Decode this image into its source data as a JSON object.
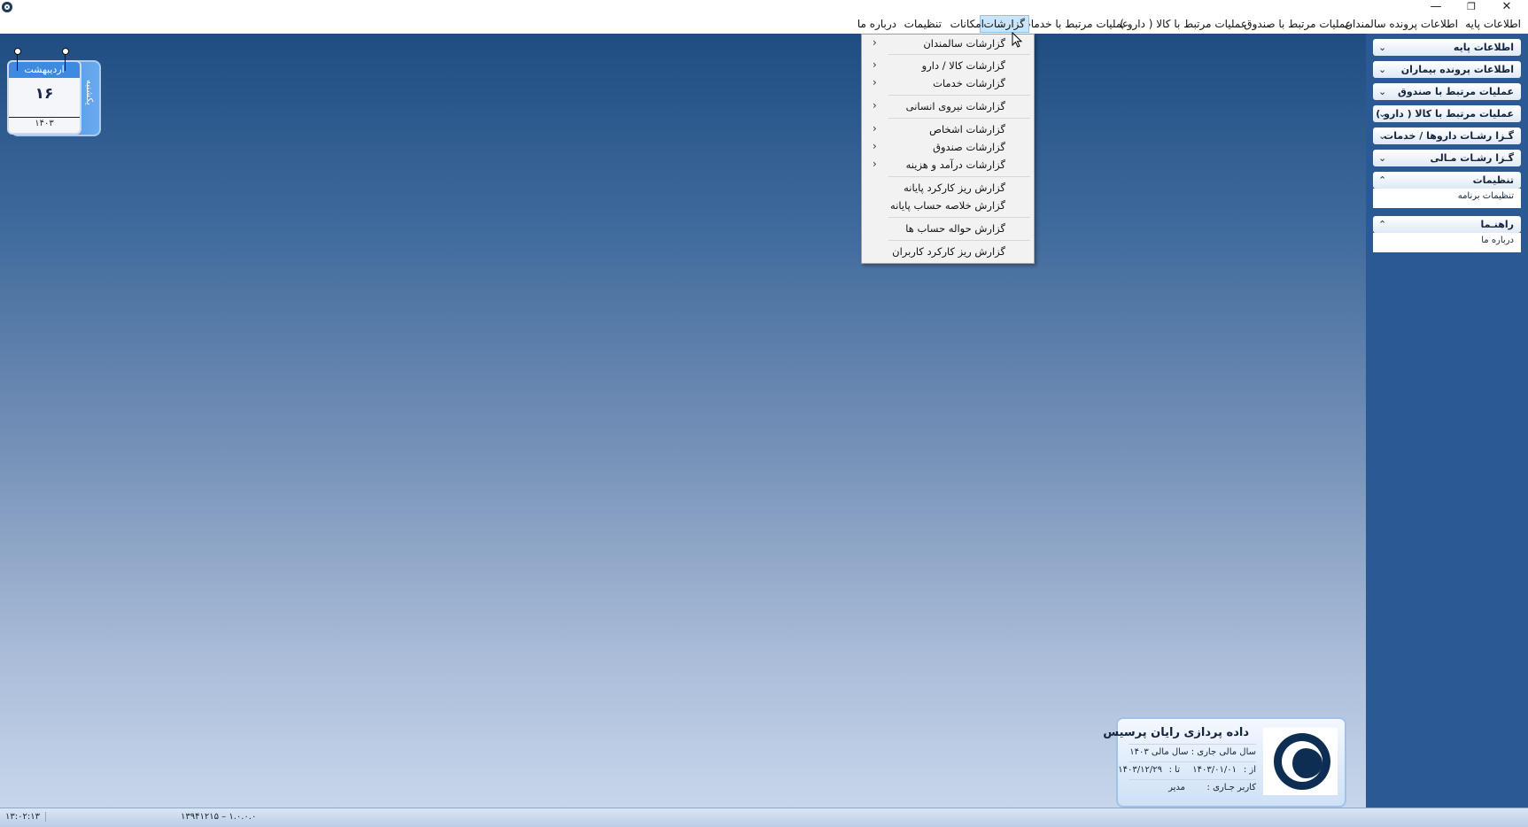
{
  "window": {
    "minimize_glyph": "—",
    "restore_glyph": "❐",
    "close_glyph": "✕"
  },
  "menubar": {
    "items": [
      {
        "label": "اطلاعات پایه"
      },
      {
        "label": "اطلاعات پرونده سالمندان"
      },
      {
        "label": "عملیات مرتبط با صندوق"
      },
      {
        "label": "عملیات مرتبط با کالا ( دارو )"
      },
      {
        "label": "عملیات مرتبط با خدمات"
      },
      {
        "label": "گزارشات"
      },
      {
        "label": "امکانات"
      },
      {
        "label": "تنظیمات"
      },
      {
        "label": "درباره ما"
      }
    ],
    "active": "گزارشات"
  },
  "reports_menu": {
    "items": [
      {
        "label": "گزارشات سالمندان",
        "submenu": true
      },
      {
        "label": "گزارشات کالا / دارو",
        "submenu": true
      },
      {
        "label": "گزارشات خدمات",
        "submenu": true
      },
      {
        "label": "گزارشات نیروی انسانی",
        "submenu": true
      },
      {
        "label": "گزارشات اشخاص",
        "submenu": true
      },
      {
        "label": "گزارشات صندوق",
        "submenu": true
      },
      {
        "label": "گزارشات درآمد و هزینه",
        "submenu": true
      },
      {
        "label": "گزارش ریز کارکرد پایانه",
        "submenu": false
      },
      {
        "label": "گزارش خلاصه حساب پایانه",
        "submenu": false
      },
      {
        "label": "گزارش حواله حساب ها",
        "submenu": false
      },
      {
        "label": "گزارش ریز کارکرد کاربران",
        "submenu": false
      }
    ],
    "submenu_arrow": "‹"
  },
  "sidepanel": {
    "sections": [
      {
        "label": "اطلاعات پایه",
        "expanded": false,
        "chevron": "⌄"
      },
      {
        "label": "اطلاعات پرونده بیماران",
        "expanded": false,
        "chevron": "⌄"
      },
      {
        "label": "عملیات مرتبط با صندوق",
        "expanded": false,
        "chevron": "⌄"
      },
      {
        "label": "عملیات مرتبط با کالا ( دارو )",
        "expanded": false,
        "chevron": "⌄"
      },
      {
        "label": "گـزا رشـات داروها / خدمات",
        "expanded": false,
        "chevron": "⌄"
      },
      {
        "label": "گـزا رشـات مـالی",
        "expanded": false,
        "chevron": "⌄"
      },
      {
        "label": "تنظیمات",
        "expanded": true,
        "chevron": "⌃",
        "children": [
          {
            "label": "تنظیمات برنامه"
          }
        ]
      },
      {
        "label": "راهنـما",
        "expanded": true,
        "chevron": "⌃",
        "children": [
          {
            "label": "درباره ما"
          }
        ]
      }
    ]
  },
  "calendar": {
    "month": "اردیبهشت",
    "day": "۱۶",
    "year": "۱۴۰۳",
    "weekday": "یکشنبه"
  },
  "company_card": {
    "company": "داده پردازی رایان پرسیس",
    "fiscal_year": "سال مالی جاری  :  سال مالی ۱۴۰۳",
    "from_label": "از :",
    "from_date": "۱۴۰۳/۰۱/۰۱",
    "to_label": "تا :",
    "to_date": "۱۴۰۳/۱۲/۲۹",
    "user_label": "کاربر جـاری :",
    "user_value": "مدیر"
  },
  "statusbar": {
    "time": "۱۳:۰۲:۱۳",
    "version": "۱۳۹۴۱۲۱۵ – ۱.۰.۰.۰"
  }
}
